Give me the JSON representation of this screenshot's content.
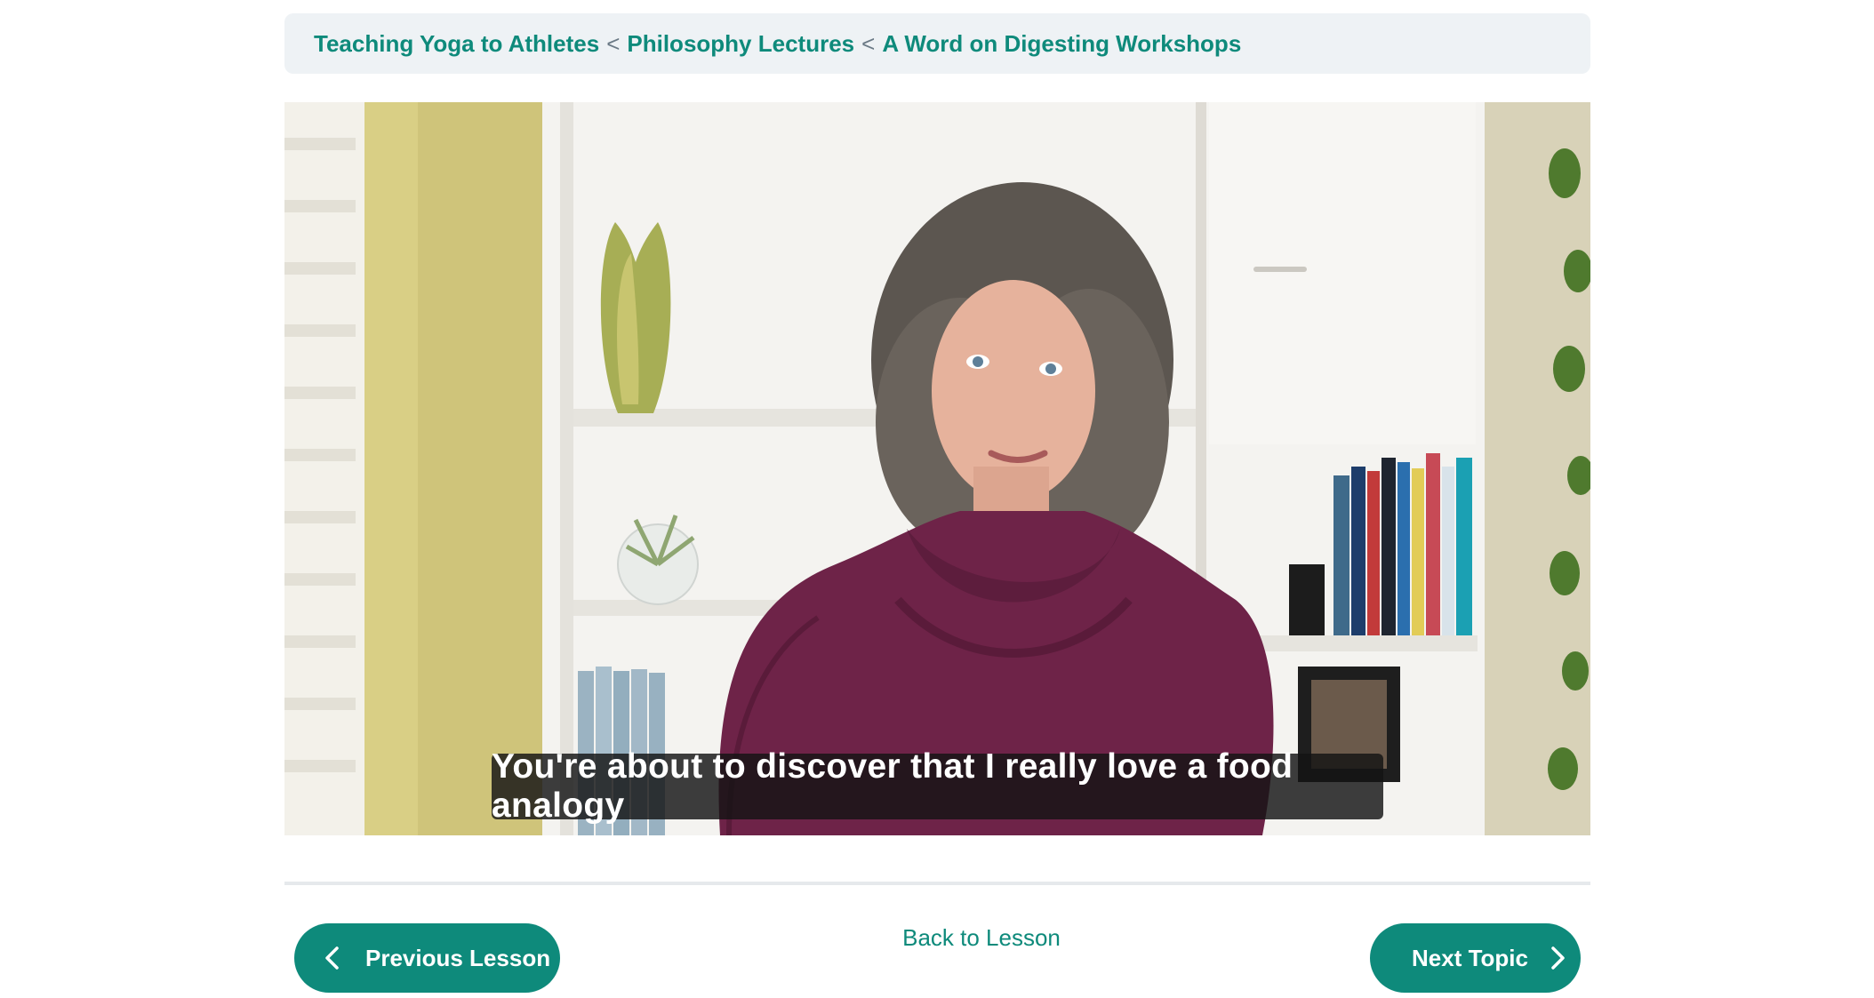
{
  "breadcrumb": {
    "items": [
      {
        "label": "Teaching Yoga to Athletes"
      },
      {
        "label": "Philosophy Lectures"
      },
      {
        "label": "A Word on Digesting Workshops"
      }
    ],
    "separator": "<"
  },
  "video": {
    "caption": "You're about to discover that I really love a food analogy"
  },
  "nav": {
    "previous_label": "Previous Lesson",
    "back_label": "Back to Lesson",
    "next_label": "Next Topic"
  },
  "colors": {
    "accent": "#0e8a7b",
    "breadcrumb_bg": "#eef2f5"
  },
  "icons": {
    "previous": "chevron-left-icon",
    "next": "chevron-right-icon"
  }
}
